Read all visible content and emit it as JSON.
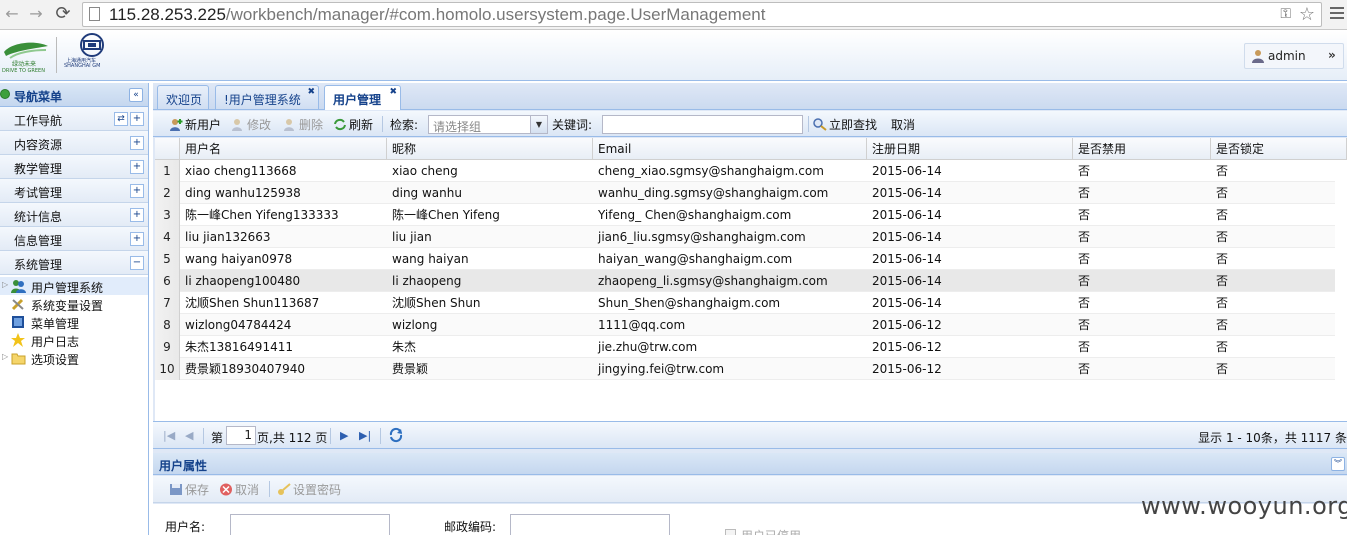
{
  "browser": {
    "url_host": "115.28.253.225",
    "url_path": "/workbench/manager/#com.homolo.usersystem.page.UserManagement"
  },
  "header": {
    "logo1_caption": "DRIVE TO GREEN",
    "logo2_caption": "SHANGHAI GM",
    "logo2_cn": "上海通用汽车",
    "user_name": "admin",
    "user_chevron": "»"
  },
  "sidebar": {
    "title": "导航菜单",
    "sections": [
      {
        "label": "工作导航",
        "btn": "+"
      },
      {
        "label": "内容资源",
        "btn": "+"
      },
      {
        "label": "教学管理",
        "btn": "+"
      },
      {
        "label": "考试管理",
        "btn": "+"
      },
      {
        "label": "统计信息",
        "btn": "+"
      },
      {
        "label": "信息管理",
        "btn": "+"
      },
      {
        "label": "系统管理",
        "btn": "−"
      }
    ],
    "tree": [
      {
        "label": "用户管理系统",
        "icon": "users-icon"
      },
      {
        "label": "系统变量设置",
        "icon": "tools-icon"
      },
      {
        "label": "菜单管理",
        "icon": "menu-icon"
      },
      {
        "label": "用户日志",
        "icon": "star-icon"
      },
      {
        "label": "选项设置",
        "icon": "folder-icon"
      }
    ]
  },
  "tabs": [
    {
      "label": "欢迎页"
    },
    {
      "label": "!用户管理系统"
    },
    {
      "label": "用户管理"
    }
  ],
  "toolbar": {
    "new_user": "新用户",
    "edit": "修改",
    "delete": "删除",
    "refresh": "刷新",
    "search_label": "检索:",
    "group_placeholder": "请选择组",
    "keyword_label": "关键词:",
    "search_now": "立即查找",
    "cancel": "取消"
  },
  "grid": {
    "columns": [
      "用户名",
      "昵称",
      "Email",
      "注册日期",
      "是否禁用",
      "是否锁定"
    ],
    "rows": [
      {
        "n": "1",
        "username": "xiao cheng113668",
        "nickname": "xiao cheng",
        "email": "cheng_xiao.sgmsy@shanghaigm.com",
        "date": "2015-06-14",
        "disabled": "否",
        "locked": "否"
      },
      {
        "n": "2",
        "username": "ding wanhu125938",
        "nickname": "ding wanhu",
        "email": "wanhu_ding.sgmsy@shanghaigm.com",
        "date": "2015-06-14",
        "disabled": "否",
        "locked": "否"
      },
      {
        "n": "3",
        "username": "陈一峰Chen Yifeng133333",
        "nickname": "陈一峰Chen Yifeng",
        "email": "Yifeng_ Chen@shanghaigm.com",
        "date": "2015-06-14",
        "disabled": "否",
        "locked": "否"
      },
      {
        "n": "4",
        "username": "liu jian132663",
        "nickname": "liu jian",
        "email": "jian6_liu.sgmsy@shanghaigm.com",
        "date": "2015-06-14",
        "disabled": "否",
        "locked": "否"
      },
      {
        "n": "5",
        "username": "wang haiyan0978",
        "nickname": "wang haiyan",
        "email": "haiyan_wang@shanghaigm.com",
        "date": "2015-06-14",
        "disabled": "否",
        "locked": "否"
      },
      {
        "n": "6",
        "username": "li zhaopeng100480",
        "nickname": "li zhaopeng",
        "email": "zhaopeng_li.sgmsy@shanghaigm.com",
        "date": "2015-06-14",
        "disabled": "否",
        "locked": "否"
      },
      {
        "n": "7",
        "username": "沈顺Shen Shun113687",
        "nickname": "沈顺Shen Shun",
        "email": "Shun_Shen@shanghaigm.com",
        "date": "2015-06-14",
        "disabled": "否",
        "locked": "否"
      },
      {
        "n": "8",
        "username": "wizlong04784424",
        "nickname": "wizlong",
        "email": "1111@qq.com",
        "date": "2015-06-12",
        "disabled": "否",
        "locked": "否"
      },
      {
        "n": "9",
        "username": "朱杰13816491411",
        "nickname": "朱杰",
        "email": "jie.zhu@trw.com",
        "date": "2015-06-12",
        "disabled": "否",
        "locked": "否"
      },
      {
        "n": "10",
        "username": "费景颖18930407940",
        "nickname": "费景颖",
        "email": "jingying.fei@trw.com",
        "date": "2015-06-12",
        "disabled": "否",
        "locked": "否"
      }
    ]
  },
  "paging": {
    "page_prefix": "第",
    "page_value": "1",
    "page_suffix": "页,共 112 页",
    "info": "显示 1 - 10条，共 1117 条"
  },
  "props": {
    "title": "用户属性",
    "save": "保存",
    "cancel": "取消",
    "set_password": "设置密码",
    "username_label": "用户名:",
    "postcode_label": "邮政编码:",
    "disabled_check": "用户已停用"
  },
  "watermark": "www.wooyun.org",
  "colors": {
    "panel_border": "#99bbe8",
    "header_text": "#15428b",
    "highlight_row": "#e8e8e8"
  }
}
